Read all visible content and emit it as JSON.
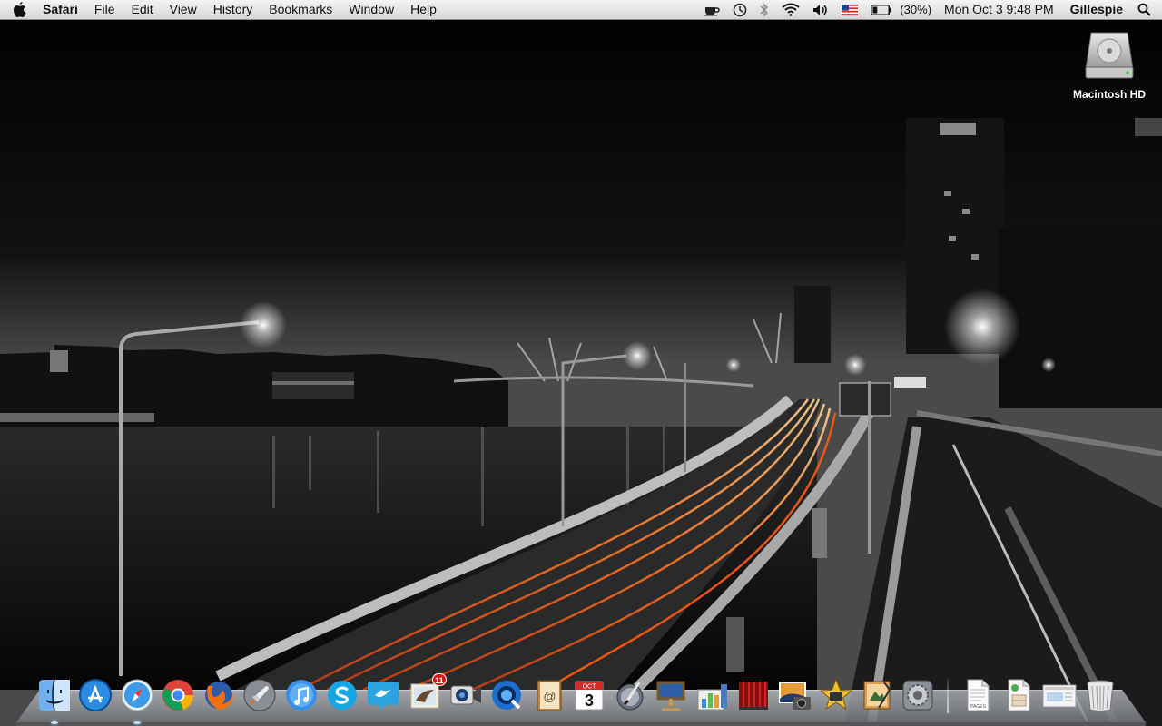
{
  "menubar": {
    "apple_icon": "apple-icon",
    "app_name": "Safari",
    "menus": [
      "File",
      "Edit",
      "View",
      "History",
      "Bookmarks",
      "Window",
      "Help"
    ],
    "status_icons": [
      "coffee-icon",
      "time-machine-icon",
      "bluetooth-icon",
      "wifi-icon",
      "volume-icon",
      "us-flag-icon",
      "battery-icon"
    ],
    "battery_text": "(30%)",
    "battery_level": 0.3,
    "clock": "Mon Oct 3  9:48 PM",
    "user": "Gillespie",
    "spotlight_icon": "spotlight-icon"
  },
  "desktop": {
    "drive_label": "Macintosh HD",
    "drive_icon": "hard-drive-icon"
  },
  "dock": {
    "apps": [
      {
        "name": "finder",
        "icon": "finder-icon",
        "running": true
      },
      {
        "name": "app-store",
        "icon": "app-store-icon",
        "running": false
      },
      {
        "name": "safari",
        "icon": "safari-icon",
        "running": true
      },
      {
        "name": "chrome",
        "icon": "chrome-icon",
        "running": false
      },
      {
        "name": "firefox",
        "icon": "firefox-icon",
        "running": false
      },
      {
        "name": "launchpad",
        "icon": "launchpad-icon",
        "running": false
      },
      {
        "name": "itunes",
        "icon": "itunes-icon",
        "running": false
      },
      {
        "name": "skype",
        "icon": "skype-icon",
        "running": false
      },
      {
        "name": "twitter",
        "icon": "twitter-icon",
        "running": false
      },
      {
        "name": "mail",
        "icon": "mail-icon",
        "running": false,
        "badge": "11"
      },
      {
        "name": "facetime",
        "icon": "facetime-icon",
        "running": false
      },
      {
        "name": "quicktime",
        "icon": "quicktime-icon",
        "running": false
      },
      {
        "name": "address-book",
        "icon": "address-book-icon",
        "running": false
      },
      {
        "name": "ical",
        "icon": "calendar-icon",
        "running": false,
        "month": "OCT",
        "day": "3"
      },
      {
        "name": "instruments",
        "icon": "instruments-icon",
        "running": false
      },
      {
        "name": "keynote",
        "icon": "keynote-icon",
        "running": false
      },
      {
        "name": "numbers",
        "icon": "numbers-icon",
        "running": false
      },
      {
        "name": "front-row",
        "icon": "front-row-icon",
        "running": false
      },
      {
        "name": "iphoto",
        "icon": "iphoto-icon",
        "running": false
      },
      {
        "name": "imovie",
        "icon": "imovie-icon",
        "running": false
      },
      {
        "name": "preview",
        "icon": "preview-icon",
        "running": false
      },
      {
        "name": "system-preferences",
        "icon": "system-preferences-icon",
        "running": false
      }
    ],
    "documents": [
      {
        "name": "pages-document",
        "icon": "pages-document-icon",
        "label": "PAGES"
      },
      {
        "name": "installer-package",
        "icon": "package-icon"
      },
      {
        "name": "screenshot-file",
        "icon": "screenshot-file-icon"
      }
    ],
    "trash_icon": "trash-icon"
  },
  "colors": {
    "menubar_top": "#f4f4f4",
    "menubar_bottom": "#d6d6d6",
    "light_trail": "#ff6a1a",
    "sky": "#0a0a0a"
  }
}
